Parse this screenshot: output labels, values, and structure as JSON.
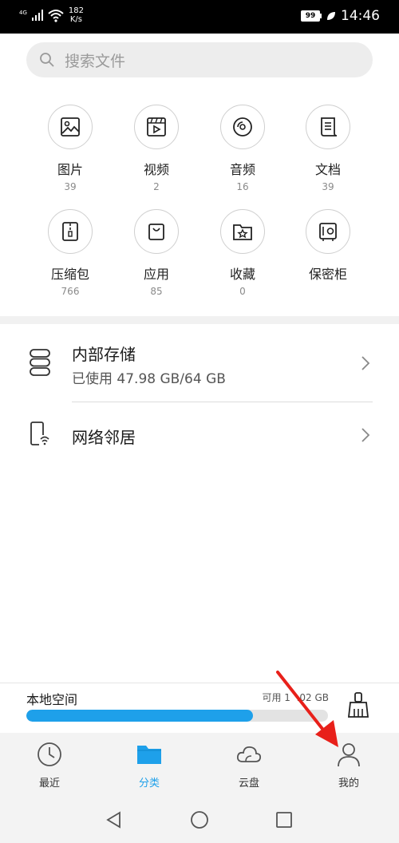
{
  "status_bar": {
    "network": "4G",
    "speed_value": "182",
    "speed_unit": "K/s",
    "battery": "99",
    "time": "14:46"
  },
  "search": {
    "placeholder": "搜索文件"
  },
  "categories": [
    {
      "label": "图片",
      "count": "39",
      "icon": "image-icon"
    },
    {
      "label": "视频",
      "count": "2",
      "icon": "video-icon"
    },
    {
      "label": "音频",
      "count": "16",
      "icon": "audio-icon"
    },
    {
      "label": "文档",
      "count": "39",
      "icon": "document-icon"
    },
    {
      "label": "压缩包",
      "count": "766",
      "icon": "archive-icon"
    },
    {
      "label": "应用",
      "count": "85",
      "icon": "app-bag-icon"
    },
    {
      "label": "收藏",
      "count": "0",
      "icon": "star-folder-icon"
    },
    {
      "label": "保密柜",
      "count": "",
      "icon": "safe-icon"
    }
  ],
  "storage": {
    "internal_title": "内部存储",
    "internal_usage": "已使用 47.98 GB/64 GB",
    "network_title": "网络邻居"
  },
  "local_space": {
    "title": "本地空间",
    "available": "可用 1  .02 GB",
    "used_fraction": 0.75
  },
  "bottom_nav": [
    {
      "label": "最近",
      "icon": "clock-icon",
      "active": false
    },
    {
      "label": "分类",
      "icon": "folder-icon",
      "active": true
    },
    {
      "label": "云盘",
      "icon": "cloud-icon",
      "active": false
    },
    {
      "label": "我的",
      "icon": "person-icon",
      "active": false
    }
  ],
  "colors": {
    "accent": "#1ea0ea",
    "annotation": "#e8201a"
  }
}
